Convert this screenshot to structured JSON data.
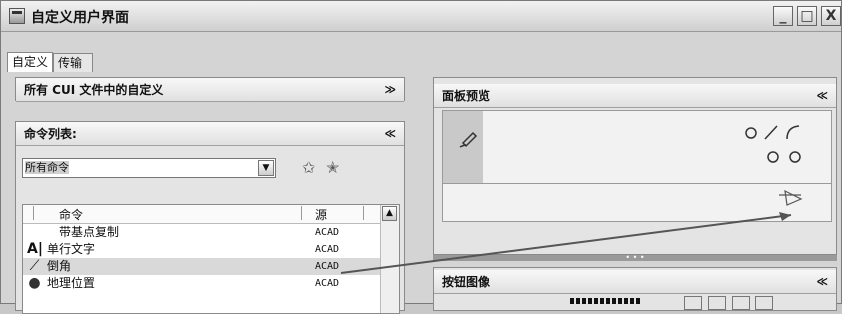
{
  "window": {
    "title": "自定义用户界面",
    "min": "_",
    "max": "□",
    "close": "X"
  },
  "tabs": [
    {
      "label": "自定义",
      "active": true
    },
    {
      "label": "传输",
      "active": false
    }
  ],
  "customizations_panel": {
    "title": "所有 CUI 文件中的自定义",
    "chevron": "≫"
  },
  "command_panel": {
    "title": "命令列表:",
    "chevron": "≪",
    "filter": {
      "value": "所有命令"
    },
    "columns": [
      "命令",
      "源"
    ],
    "rows": [
      {
        "icon": "none",
        "name": "带基点复制",
        "source": "ACAD",
        "selected": false
      },
      {
        "icon": "text-icon",
        "glyph": "A|",
        "name": "单行文字",
        "source": "ACAD",
        "selected": false
      },
      {
        "icon": "chamfer-icon",
        "glyph": "⟋",
        "name": "倒角",
        "source": "ACAD",
        "selected": true
      },
      {
        "icon": "globe-icon",
        "glyph": "●",
        "name": "地理位置",
        "source": "ACAD",
        "selected": false
      }
    ]
  },
  "preview_panel": {
    "title": "面板预览",
    "chevron": "≪"
  },
  "button_image_panel": {
    "title": "按钮图像",
    "chevron": "≪"
  },
  "colors": {
    "arrow": "#555555",
    "selected_row": "#d9d9d9"
  }
}
